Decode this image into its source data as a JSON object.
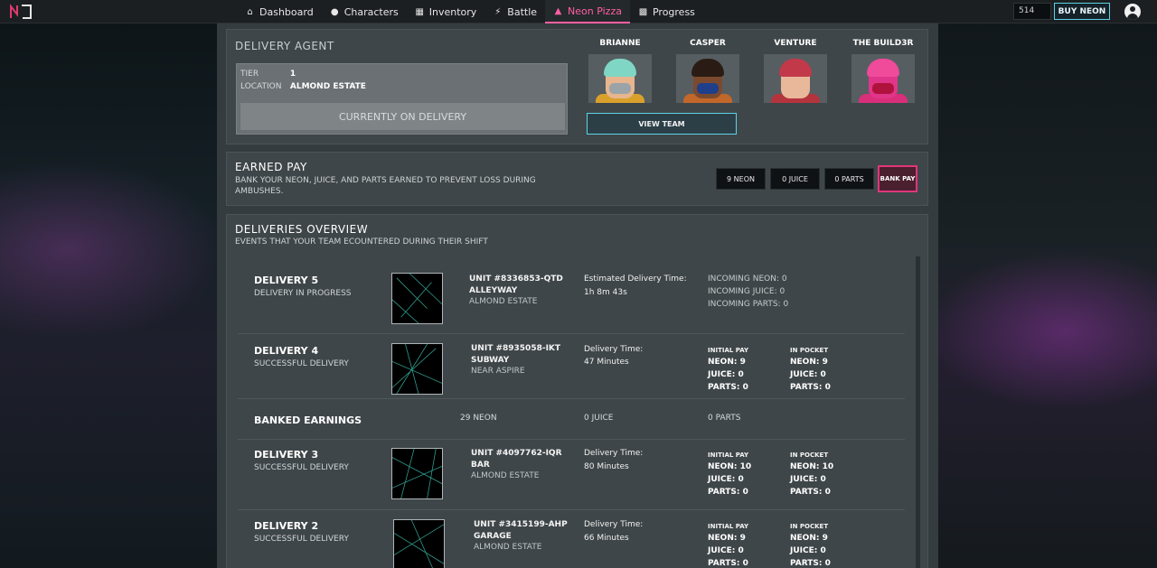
{
  "nav": {
    "items": [
      {
        "label": "Dashboard",
        "icon": "home-icon"
      },
      {
        "label": "Characters",
        "icon": "user-icon"
      },
      {
        "label": "Inventory",
        "icon": "grid-icon"
      },
      {
        "label": "Battle",
        "icon": "bolt-icon"
      },
      {
        "label": "Neon Pizza",
        "icon": "flame-icon"
      },
      {
        "label": "Progress",
        "icon": "bar-chart-icon"
      }
    ],
    "neon_balance": "514",
    "buy_label": "BUY NEON"
  },
  "agent": {
    "title": "DELIVERY AGENT",
    "tier_label": "TIER",
    "tier_value": "1",
    "location_label": "LOCATION",
    "location_value": "ALMOND ESTATE",
    "status": "CURRENTLY ON DELIVERY",
    "team": [
      "BRIANNE",
      "CASPER",
      "VENTURE",
      "THE BUILD3R"
    ],
    "view_team_label": "VIEW TEAM"
  },
  "earned": {
    "title": "EARNED PAY",
    "desc": "BANK YOUR NEON, JUICE, AND PARTS EARNED TO PREVENT LOSS DURING AMBUSHES.",
    "neon": "9 NEON",
    "juice": "0 JUICE",
    "parts": "0 PARTS",
    "bank_label": "BANK PAY"
  },
  "overview": {
    "title": "DELIVERIES OVERVIEW",
    "desc": "EVENTS THAT YOUR TEAM ECOUNTERED DURING THEIR SHIFT",
    "current": {
      "title": "DELIVERY 5",
      "status": "DELIVERY IN PROGRESS",
      "unit": "UNIT #8336853-QTD",
      "place": "ALLEYWAY",
      "location": "ALMOND ESTATE",
      "time_label": "Estimated Delivery Time:",
      "time_value": "1h 8m 43s",
      "incoming_neon": "INCOMING NEON: 0",
      "incoming_juice": "INCOMING JUICE: 0",
      "incoming_parts": "INCOMING PARTS: 0"
    },
    "deliveries": [
      {
        "title": "DELIVERY 4",
        "status": "SUCCESSFUL DELIVERY",
        "unit": "UNIT #8935058-IKT",
        "place": "SUBWAY",
        "location": "NEAR ASPIRE",
        "time_label": "Delivery Time:",
        "time_value": "47 Minutes",
        "initial_head": "INITIAL PAY",
        "pocket_head": "IN POCKET",
        "initial": [
          "NEON: 9",
          "JUICE: 0",
          "PARTS: 0"
        ],
        "pocket": [
          "NEON: 9",
          "JUICE: 0",
          "PARTS: 0"
        ]
      },
      {
        "title": "DELIVERY 3",
        "status": "SUCCESSFUL DELIVERY",
        "unit": "UNIT #4097762-IQR",
        "place": "BAR",
        "location": "ALMOND ESTATE",
        "time_label": "Delivery Time:",
        "time_value": "80 Minutes",
        "initial_head": "INITIAL PAY",
        "pocket_head": "IN POCKET",
        "initial": [
          "NEON: 10",
          "JUICE: 0",
          "PARTS: 0"
        ],
        "pocket": [
          "NEON: 10",
          "JUICE: 0",
          "PARTS: 0"
        ]
      },
      {
        "title": "DELIVERY 2",
        "status": "SUCCESSFUL DELIVERY",
        "unit": "UNIT #3415199-AHP",
        "place": "GARAGE",
        "location": "ALMOND ESTATE",
        "time_label": "Delivery Time:",
        "time_value": "66 Minutes",
        "initial_head": "INITIAL PAY",
        "pocket_head": "IN POCKET",
        "initial": [
          "NEON: 9",
          "JUICE: 0",
          "PARTS: 0"
        ],
        "pocket": [
          "NEON: 9",
          "JUICE: 0",
          "PARTS: 0"
        ]
      }
    ],
    "banked": {
      "title": "BANKED EARNINGS",
      "neon": "29 NEON",
      "juice": "0 JUICE",
      "parts": "0 PARTS"
    }
  }
}
